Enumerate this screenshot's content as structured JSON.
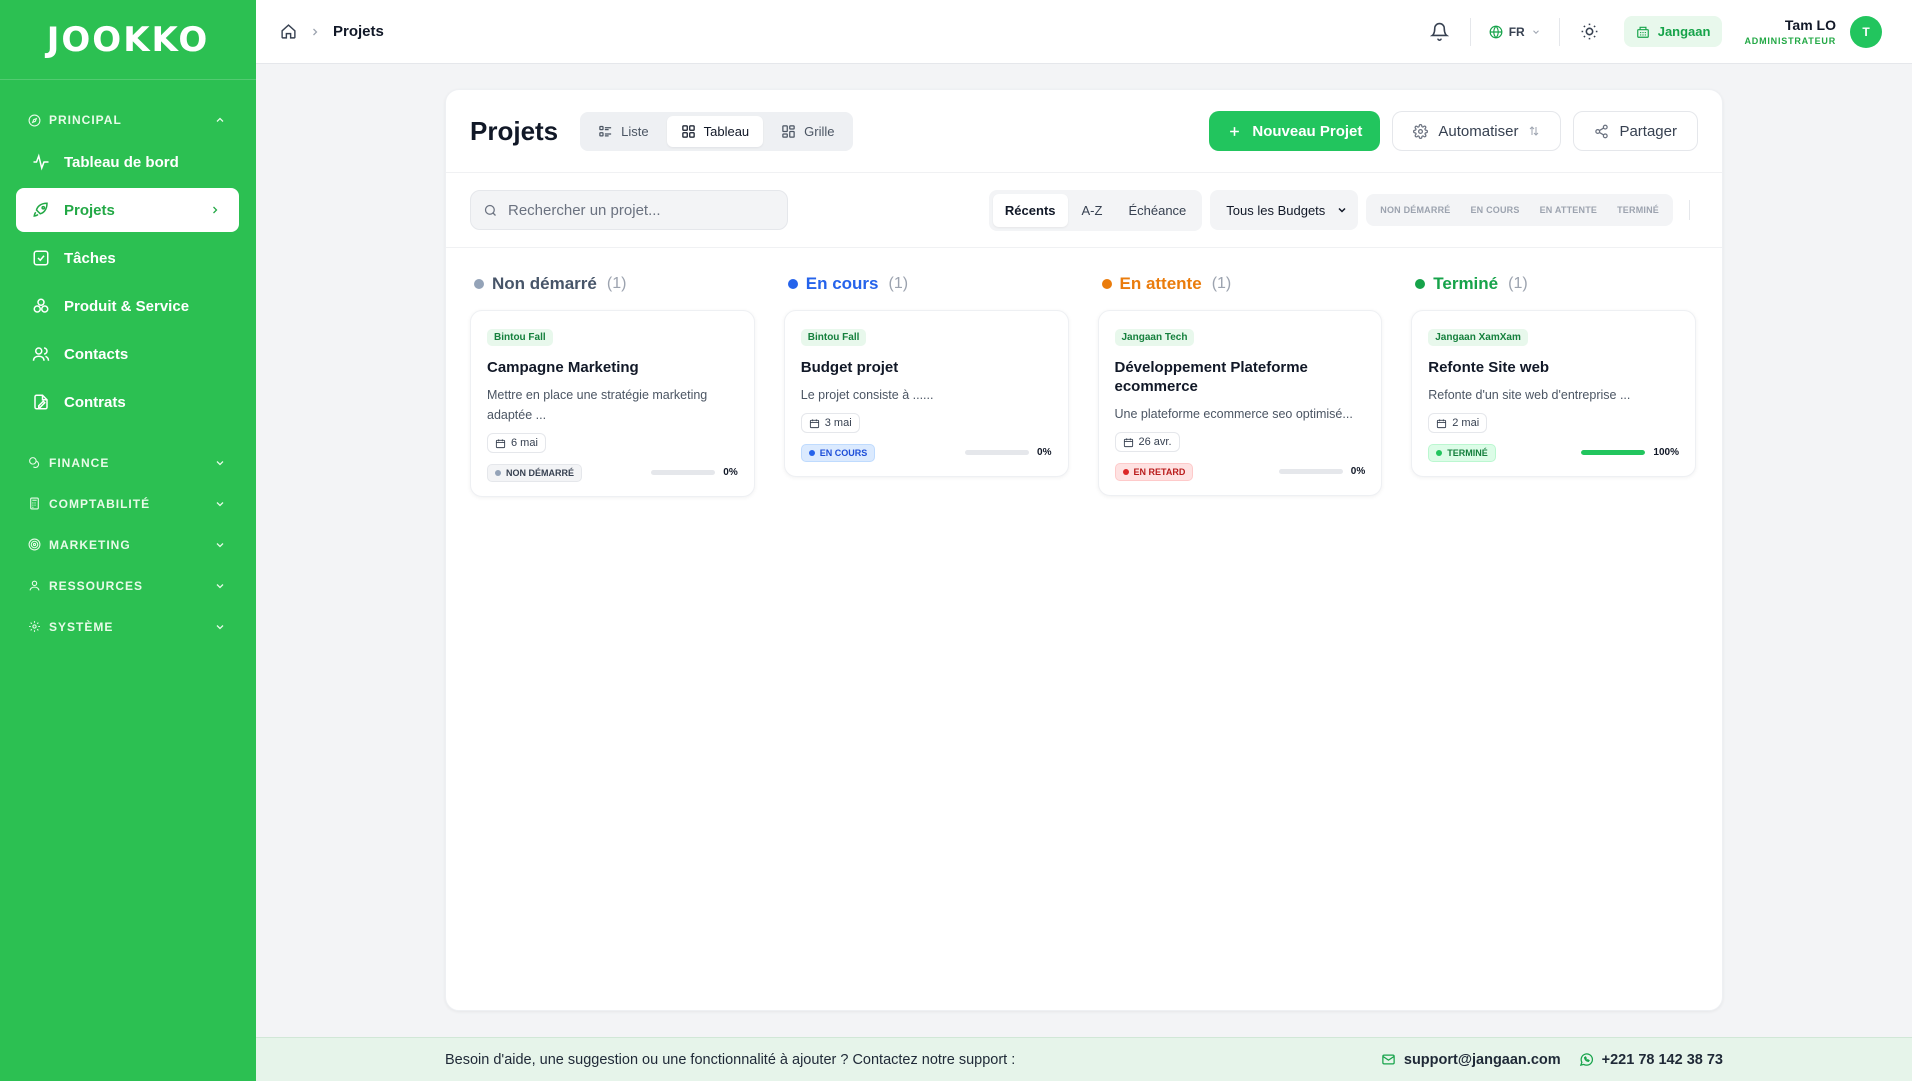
{
  "brand": {
    "logo_text": "JOOKKO"
  },
  "sidebar": {
    "principal_label": "PRINCIPAL",
    "items": [
      {
        "label": "Tableau de bord",
        "icon": "activity-icon"
      },
      {
        "label": "Projets",
        "icon": "rocket-icon"
      },
      {
        "label": "Tâches",
        "icon": "checkbox-icon"
      },
      {
        "label": "Produit & Service",
        "icon": "boxes-icon"
      },
      {
        "label": "Contacts",
        "icon": "users-icon"
      },
      {
        "label": "Contrats",
        "icon": "contract-icon"
      }
    ],
    "groups": [
      {
        "label": "FINANCE"
      },
      {
        "label": "COMPTABILITÉ"
      },
      {
        "label": "MARKETING"
      },
      {
        "label": "RESSOURCES"
      },
      {
        "label": "SYSTÈME"
      }
    ]
  },
  "topbar": {
    "breadcrumb_current": "Projets",
    "lang": "FR",
    "company": "Jangaan",
    "user_name": "Tam LO",
    "user_role": "ADMINISTRATEUR",
    "avatar_initial": "T"
  },
  "page": {
    "title": "Projets",
    "views": [
      "Liste",
      "Tableau",
      "Grille"
    ],
    "active_view": "Tableau",
    "new_project": "Nouveau Projet",
    "automate": "Automatiser",
    "share": "Partager",
    "search_placeholder": "Rechercher un projet...",
    "sorts": [
      "Récents",
      "A-Z",
      "Échéance"
    ],
    "budget_filter": "Tous les Budgets",
    "status_filters": [
      "NON DÉMARRÉ",
      "EN COURS",
      "EN ATTENTE",
      "TERMINÉ"
    ]
  },
  "columns": [
    {
      "title": "Non démarré",
      "count": "(1)",
      "color": "#94a3b8",
      "cards": [
        {
          "client": "Bintou Fall",
          "title": "Campagne Marketing",
          "desc": "Mettre en place une stratégie marketing adaptée ...",
          "date": "6 mai",
          "status": "NON DÉMARRÉ",
          "status_bg": "#f3f4f6",
          "status_fg": "#374151",
          "status_dot": "#94a3b8",
          "progress_text": "0%",
          "progress": 0
        }
      ]
    },
    {
      "title": "En cours",
      "count": "(1)",
      "color": "#2563eb",
      "cards": [
        {
          "client": "Bintou Fall",
          "title": "Budget projet",
          "desc": "Le projet consiste à ......",
          "date": "3 mai",
          "status": "EN COURS",
          "status_bg": "#dbeafe",
          "status_fg": "#1d4ed8",
          "status_dot": "#2563eb",
          "progress_text": "0%",
          "progress": 0
        }
      ]
    },
    {
      "title": "En attente",
      "count": "(1)",
      "color": "#ea7c0c",
      "cards": [
        {
          "client": "Jangaan Tech",
          "title": "Développement Plateforme ecommerce",
          "desc": "Une plateforme ecommerce seo optimisé...",
          "date": "26 avr.",
          "status": "EN RETARD",
          "status_bg": "#fee2e2",
          "status_fg": "#b91c1c",
          "status_dot": "#dc2626",
          "progress_text": "0%",
          "progress": 0
        }
      ]
    },
    {
      "title": "Terminé",
      "count": "(1)",
      "color": "#16a34a",
      "cards": [
        {
          "client": "Jangaan XamXam",
          "title": "Refonte Site web",
          "desc": "Refonte d'un site web d'entreprise ...",
          "date": "2 mai",
          "status": "TERMINÉ",
          "status_bg": "#dcfce7",
          "status_fg": "#15803d",
          "status_dot": "#22c55e",
          "progress_text": "100%",
          "progress": 100
        }
      ]
    }
  ],
  "footer": {
    "message": "Besoin d'aide, une suggestion ou une fonctionnalité à ajouter ? Contactez notre support :",
    "email": "support@jangaan.com",
    "phone": "+221 78 142 38 73"
  }
}
